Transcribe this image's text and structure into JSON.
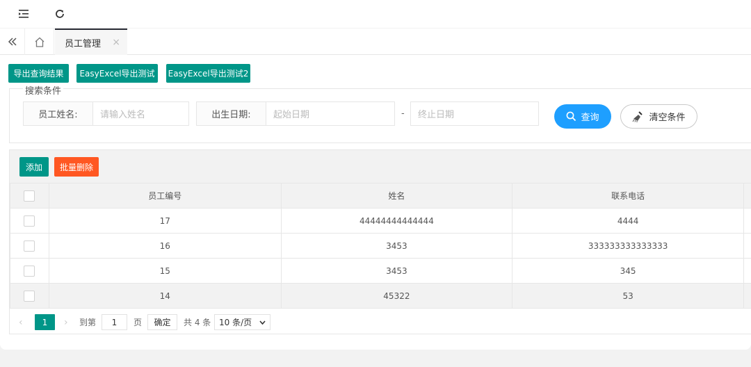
{
  "tabs": {
    "active_label": "员工管理",
    "close_glyph": "×"
  },
  "toolbar_top": {
    "export_query": "导出查询结果",
    "export_easyexcel": "EasyExcel导出测试",
    "export_easyexcel2": "EasyExcel导出测试2"
  },
  "search": {
    "legend": "搜索条件",
    "name_label": "员工姓名:",
    "name_placeholder": "请输入姓名",
    "birth_label": "出生日期:",
    "birth_start_placeholder": "起始日期",
    "dash": "-",
    "birth_end_placeholder": "终止日期",
    "search_button": "查询",
    "clear_button": "清空条件"
  },
  "table_toolbar": {
    "add": "添加",
    "batch_delete": "批量删除"
  },
  "table": {
    "columns": [
      "员工编号",
      "姓名",
      "联系电话"
    ],
    "rows": [
      {
        "id": "17",
        "name": "44444444444444",
        "phone": "4444"
      },
      {
        "id": "16",
        "name": "3453",
        "phone": "333333333333333"
      },
      {
        "id": "15",
        "name": "3453",
        "phone": "345"
      },
      {
        "id": "14",
        "name": "45322",
        "phone": "53"
      }
    ]
  },
  "pager": {
    "current_page": "1",
    "goto_label": "到第",
    "goto_value": "1",
    "page_unit": "页",
    "confirm": "确定",
    "total": "共 4 条",
    "page_size": "10 条/页"
  },
  "colors": {
    "teal": "#009688",
    "orange": "#ff5722",
    "blue": "#1e9fff"
  },
  "icons": {
    "menu": "menu-fold-icon",
    "refresh": "refresh-icon",
    "prev": "double-chevron-left-icon",
    "home": "home-icon",
    "search": "search-icon",
    "clear": "broom-icon"
  }
}
